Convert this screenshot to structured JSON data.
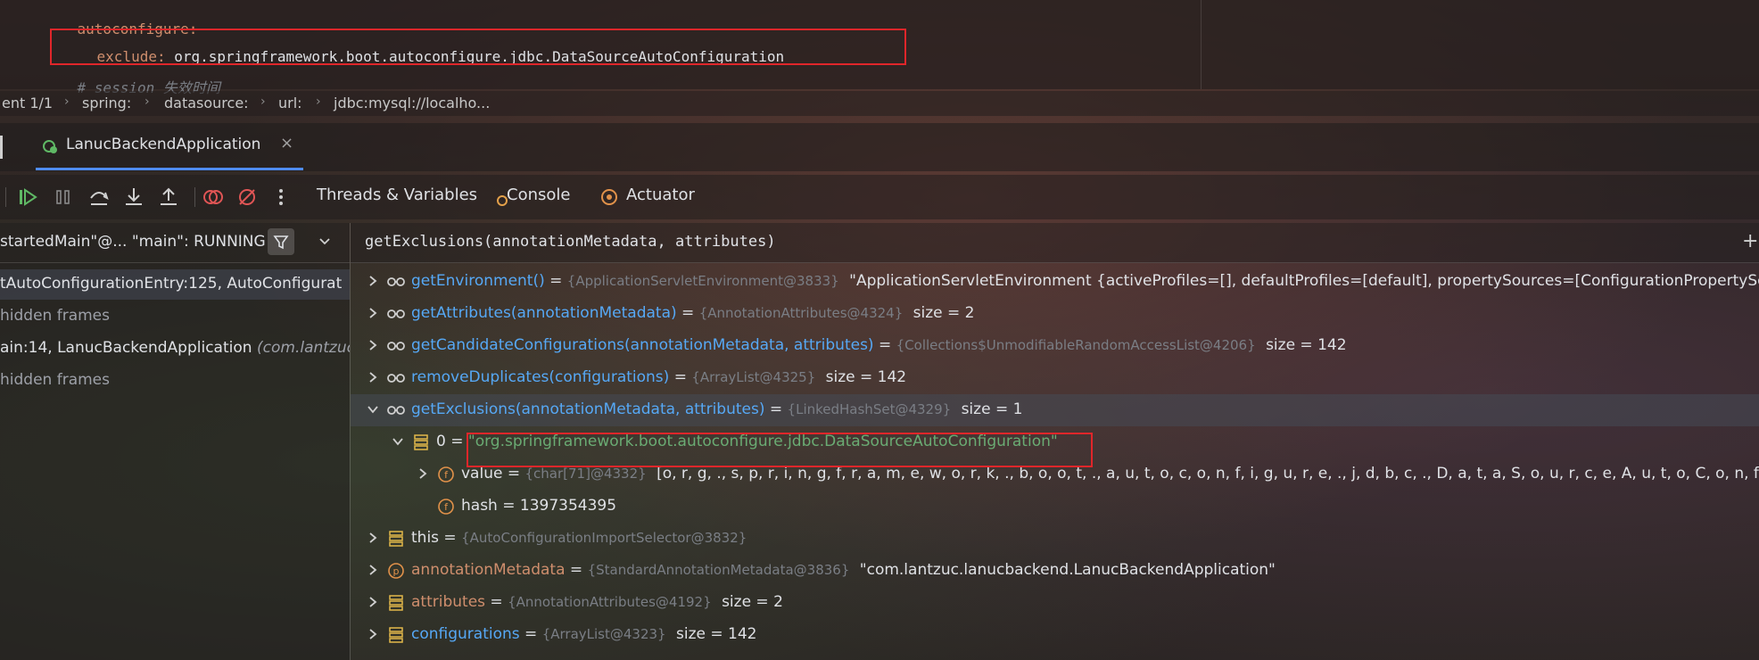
{
  "editor": {
    "line1": "autoconfigure:",
    "line2_key": "exclude:",
    "line2_value": " org.springframework.boot.autoconfigure.jdbc.DataSourceAutoConfiguration",
    "line3_comment": "# session 失效时间"
  },
  "breadcrumb": [
    "ent 1/1",
    "spring:",
    "datasource:",
    "url:",
    "jdbc:mysql://localho..."
  ],
  "run_tab": {
    "label": "LanucBackendApplication",
    "close": "×"
  },
  "toolbar": {
    "tabs": [
      "Threads & Variables",
      "Console",
      "Actuator"
    ],
    "icons": [
      "resume-icon",
      "pause-icon",
      "step-over-icon",
      "step-into-icon",
      "step-out-icon",
      "view-breakpoints-icon",
      "mute-breakpoints-icon",
      "more-icon"
    ]
  },
  "frames": {
    "thread": "startedMain\"@... \"main\": RUNNING",
    "items": [
      {
        "text": "tAutoConfigurationEntry:125, AutoConfigurat",
        "extra": "",
        "muted": false,
        "selected": true
      },
      {
        "text": "hidden frames",
        "extra": "",
        "muted": true,
        "selected": false
      },
      {
        "text": "ain:14, LanucBackendApplication",
        "extra": "(com.lantzuc",
        "muted": false,
        "selected": false
      },
      {
        "text": "hidden frames",
        "extra": "",
        "muted": true,
        "selected": false
      }
    ]
  },
  "evaluate": {
    "expression": "getExclusions(annotationMetadata, attributes)",
    "add": "+"
  },
  "variables": [
    {
      "arrow": "right",
      "icon": "watch-icon",
      "indent": 0,
      "name": "getEnvironment()",
      "kind": "method",
      "ref": "{ApplicationServletEnvironment@3833}",
      "value": "\"ApplicationServletEnvironment {activeProfiles=[], defaultProfiles=[default], propertySources=[ConfigurationPropertySource",
      "value_kind": "plain"
    },
    {
      "arrow": "right",
      "icon": "watch-icon",
      "indent": 0,
      "name": "getAttributes(annotationMetadata)",
      "kind": "method",
      "ref": "{AnnotationAttributes@4324}",
      "value": "size = 2",
      "value_kind": "plain"
    },
    {
      "arrow": "right",
      "icon": "watch-icon",
      "indent": 0,
      "name": "getCandidateConfigurations(annotationMetadata, attributes)",
      "kind": "method",
      "ref": "{Collections$UnmodifiableRandomAccessList@4206}",
      "value": "size = 142",
      "value_kind": "plain"
    },
    {
      "arrow": "right",
      "icon": "watch-icon",
      "indent": 0,
      "name": "removeDuplicates(configurations)",
      "kind": "method",
      "ref": "{ArrayList@4325}",
      "value": "size = 142",
      "value_kind": "plain"
    },
    {
      "arrow": "down",
      "icon": "watch-icon",
      "indent": 0,
      "name": "getExclusions(annotationMetadata, attributes)",
      "kind": "method",
      "ref": "{LinkedHashSet@4329}",
      "value": "size = 1",
      "value_kind": "plain",
      "selected": true
    },
    {
      "arrow": "down",
      "icon": "array-icon",
      "indent": 1,
      "name": "0",
      "kind": "plain",
      "ref": "",
      "value": "\"org.springframework.boot.autoconfigure.jdbc.DataSourceAutoConfiguration\"",
      "value_kind": "string"
    },
    {
      "arrow": "right",
      "icon": "field-icon",
      "indent": 2,
      "name": "value",
      "kind": "plain",
      "ref": "{char[71]@4332}",
      "value": "[o, r, g, ., s, p, r, i, n, g, f, r, a, m, e, w, o, r, k, ., b, o, o, t, ., a, u, t, o, c, o, n, f, i, g, u, r, e, ., j, d, b, c, ., D, a, t, a, S, o, u, r, c, e, A, u, t, o, C, o, n, f, i, g, u, r, a, t, i, o,",
      "value_kind": "plain"
    },
    {
      "arrow": "none",
      "icon": "field-icon",
      "indent": 2,
      "name": "hash",
      "kind": "plain",
      "ref": "",
      "value": "1397354395",
      "value_kind": "plain"
    },
    {
      "arrow": "right",
      "icon": "array-icon",
      "indent": 0,
      "name": "this",
      "kind": "plain",
      "ref": "{AutoConfigurationImportSelector@3832}",
      "value": "",
      "value_kind": "plain"
    },
    {
      "arrow": "right",
      "icon": "param-icon",
      "indent": 0,
      "name": "annotationMetadata",
      "kind": "field",
      "ref": "{StandardAnnotationMetadata@3836}",
      "value": "\"com.lantzuc.lanucbackend.LanucBackendApplication\"",
      "value_kind": "plain"
    },
    {
      "arrow": "right",
      "icon": "array-icon",
      "indent": 0,
      "name": "attributes",
      "kind": "field",
      "ref": "{AnnotationAttributes@4192}",
      "value": "size = 2",
      "value_kind": "plain"
    },
    {
      "arrow": "right",
      "icon": "array-icon",
      "indent": 0,
      "name": "configurations",
      "kind": "method",
      "ref": "{ArrayList@4323}",
      "value": "size = 142",
      "value_kind": "plain"
    }
  ],
  "colors": {
    "highlight": "#e0262a",
    "method": "#56a8f5",
    "string": "#6aab73",
    "keyword": "#cf8e6d"
  }
}
